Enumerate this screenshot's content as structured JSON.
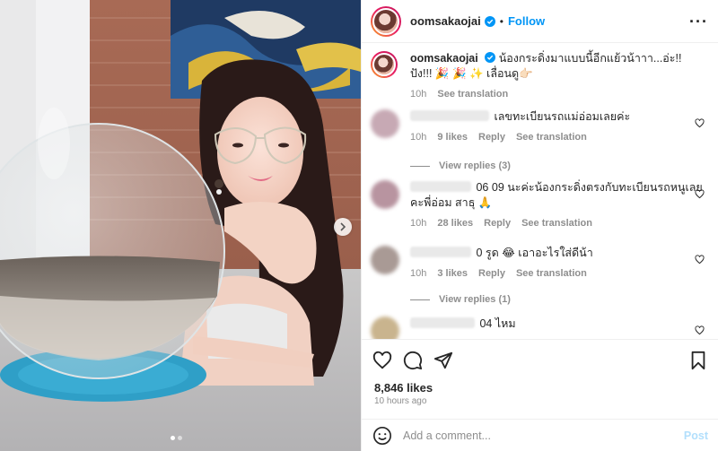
{
  "header": {
    "username": "oomsakaojai",
    "separator": "•",
    "follow_label": "Follow",
    "more_label": "···"
  },
  "caption": {
    "username": "oomsakaojai",
    "text": "น้องกระดิ่งมาแบบนี้อีกแย้วน้าาา...อ่ะ!!ปัง!!! 🎉 🎉 ✨ เลื่อนดู👉🏻",
    "time": "10h",
    "see_translation": "See translation"
  },
  "comments": [
    {
      "text": "เลขทะเบียนรถแม่อ่อมเลยค่ะ",
      "time": "10h",
      "likes": "9 likes",
      "reply": "Reply",
      "see_translation": "See translation",
      "view_replies": "View replies (3)"
    },
    {
      "text": "06 09 นะค่ะน้องกระดิ่งตรงกับทะเบียนรถหนูเลยคะพี่อ่อม สาธุ 🙏",
      "time": "10h",
      "likes": "28 likes",
      "reply": "Reply",
      "see_translation": "See translation"
    },
    {
      "text": "0 รูด 😂 เอาอะไรใส่ดีน้า",
      "time": "10h",
      "likes": "3 likes",
      "reply": "Reply",
      "see_translation": "See translation",
      "view_replies": "View replies (1)"
    },
    {
      "text": "04 ไหม"
    }
  ],
  "engagement": {
    "likes": "8,846 likes",
    "time_ago": "10 hours ago"
  },
  "add_comment": {
    "placeholder": "Add a comment...",
    "post_label": "Post"
  },
  "icons": {
    "like": "heart-icon",
    "comment": "comment-icon",
    "share": "share-icon",
    "save": "bookmark-icon",
    "emoji": "emoji-icon",
    "next": "chevron-right-icon",
    "verified": "verified-badge-icon"
  },
  "colors": {
    "accent": "#0095f6",
    "muted": "#8e8e8e",
    "post_disabled": "#b2dffc"
  },
  "carousel": {
    "count": 2,
    "active": 0
  }
}
